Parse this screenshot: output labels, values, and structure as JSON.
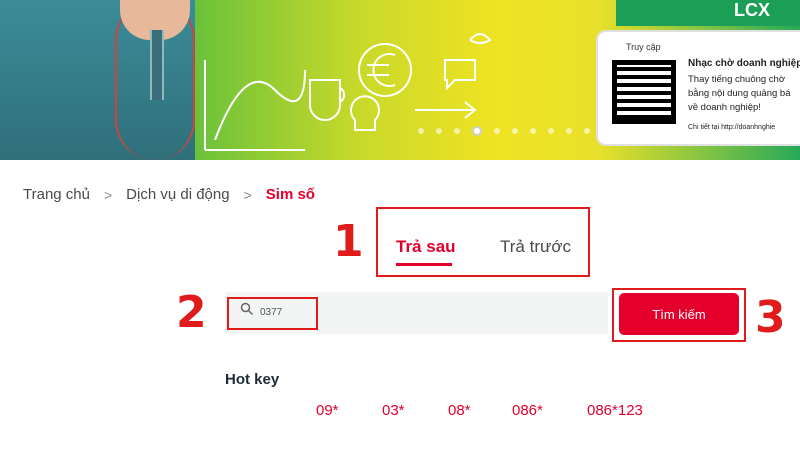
{
  "banner": {
    "qr_label": "Truy cập",
    "promo_title": "Nhạc chờ doanh nghiệp",
    "promo_lines": [
      "Thay tiếng chuông chờ",
      "bằng nội dung quảng bá",
      "về doanh nghiệp!"
    ],
    "promo_footer": "Chi tiết tại http://doanhnghie",
    "green_tab_text": "LCX",
    "active_dot": 3,
    "dot_count": 12
  },
  "breadcrumb": {
    "home": "Trang chủ",
    "mobile": "Dịch vụ di động",
    "current": "Sim số"
  },
  "tabs": {
    "postpaid": "Trả sau",
    "prepaid": "Trả trước",
    "active": "postpaid"
  },
  "search": {
    "value": "0377",
    "button_label": "Tìm kiếm"
  },
  "annotations": {
    "one": "1",
    "two": "2",
    "three": "3"
  },
  "hotkeys": {
    "title": "Hot key",
    "items": [
      "09*",
      "03*",
      "08*",
      "086*",
      "086*123"
    ]
  },
  "colors": {
    "accent": "#e5002b",
    "annotation": "#e01b1b"
  }
}
